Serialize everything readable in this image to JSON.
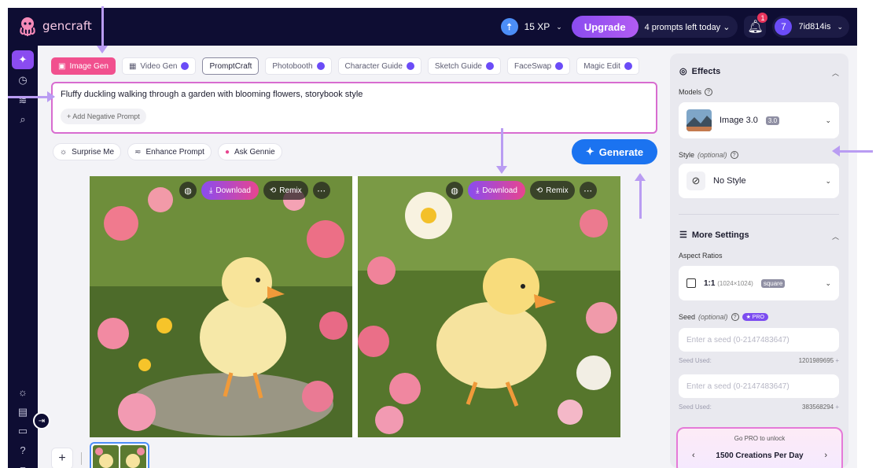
{
  "header": {
    "logo_text": "gencraft",
    "xp": "15 XP",
    "upgrade": "Upgrade",
    "prompts_left": "4 prompts left today",
    "notif_count": "1",
    "user_initial": "7",
    "username": "7id814is"
  },
  "tabs": [
    {
      "label": "Image Gen"
    },
    {
      "label": "Video Gen"
    },
    {
      "label": "PromptCraft"
    },
    {
      "label": "Photobooth"
    },
    {
      "label": "Character Guide"
    },
    {
      "label": "Sketch Guide"
    },
    {
      "label": "FaceSwap"
    },
    {
      "label": "Magic Edit"
    }
  ],
  "prompt": {
    "text": "Fluffy duckling walking through a garden with blooming flowers, storybook style",
    "negative": "+ Add Negative Prompt"
  },
  "actions": {
    "surprise": "Surprise Me",
    "enhance": "Enhance Prompt",
    "ask": "Ask Gennie",
    "generate": "Generate"
  },
  "image_actions": {
    "download": "Download",
    "remix": "Remix"
  },
  "panel": {
    "effects": "Effects",
    "models_label": "Models",
    "model_name": "Image 3.0",
    "model_tag": "3.0",
    "style_label": "Style",
    "style_optional": "(optional)",
    "style_value": "No Style",
    "more_settings": "More Settings",
    "aspect_label": "Aspect Ratios",
    "aspect_value": "1:1",
    "aspect_dim": "(1024×1024)",
    "aspect_tag": "square",
    "seed_label": "Seed",
    "seed_optional": "(optional)",
    "seed_pro": "★ PRO",
    "seed_placeholder": "Enter a seed (0-2147483647)",
    "seed_used_label": "Seed Used:",
    "seed_used_1": "1201989695",
    "seed_used_2": "383568294",
    "seed_plus": "+",
    "pro_title": "Go PRO to unlock",
    "pro_main": "1500 Creations Per Day"
  }
}
